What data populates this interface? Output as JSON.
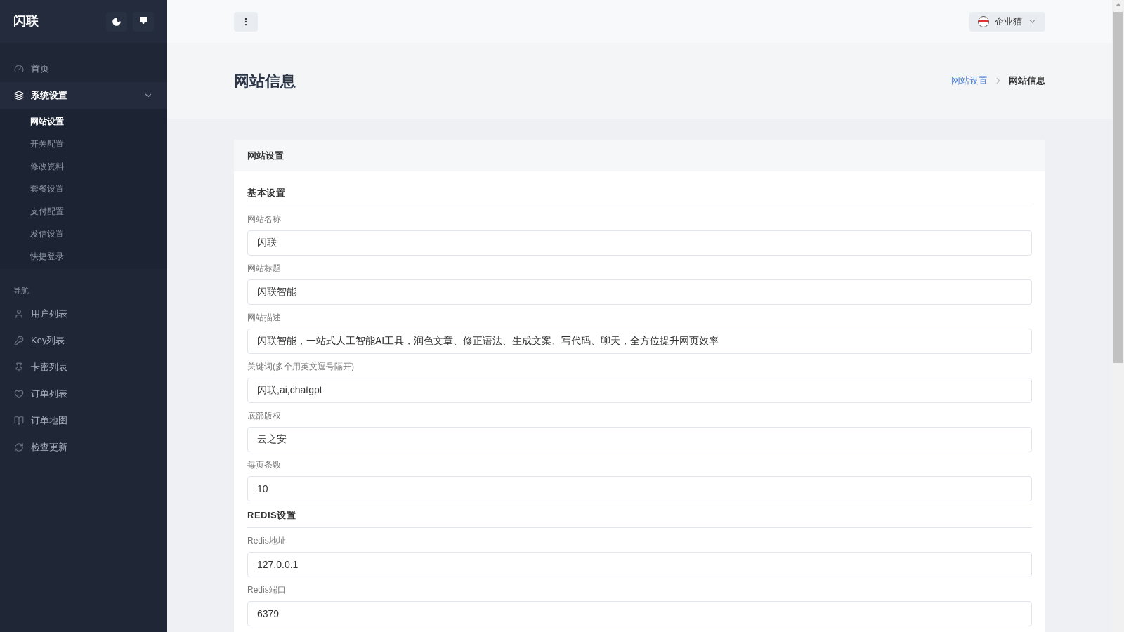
{
  "sidebar": {
    "brand": "闪联",
    "menu": [
      {
        "label": "首页",
        "selected": false
      },
      {
        "label": "系统设置",
        "selected": true,
        "expanded": true,
        "children": [
          {
            "label": "网站设置",
            "selected": true
          },
          {
            "label": "开关配置",
            "selected": false
          },
          {
            "label": "修改资料",
            "selected": false
          },
          {
            "label": "套餐设置",
            "selected": false
          },
          {
            "label": "支付配置",
            "selected": false
          },
          {
            "label": "发信设置",
            "selected": false
          },
          {
            "label": "快捷登录",
            "selected": false
          }
        ]
      }
    ],
    "nav_heading": "导航",
    "nav_items": [
      {
        "label": "用户列表",
        "selected": false
      },
      {
        "label": "Key列表",
        "selected": false
      },
      {
        "label": "卡密列表",
        "selected": false
      },
      {
        "label": "订单列表",
        "selected": false
      },
      {
        "label": "订单地图",
        "selected": false
      },
      {
        "label": "检查更新",
        "selected": false
      }
    ]
  },
  "topbar": {
    "user": "企业猫"
  },
  "page": {
    "title": "网站信息",
    "breadcrumb": [
      {
        "label": "网站设置",
        "link": true
      },
      {
        "label": "网站信息",
        "link": false
      }
    ]
  },
  "card": {
    "title": "网站设置",
    "sections": [
      {
        "heading": "基本设置",
        "fields": [
          {
            "label": "网站名称",
            "value": "闪联"
          },
          {
            "label": "网站标题",
            "value": "闪联智能"
          },
          {
            "label": "网站描述",
            "value": "闪联智能，一站式人工智能AI工具，润色文章、修正语法、生成文案、写代码、聊天，全方位提升网页效率"
          },
          {
            "label": "关键词(多个用英文逗号隔开)",
            "value": "闪联,ai,chatgpt"
          },
          {
            "label": "底部版权",
            "value": "云之安"
          },
          {
            "label": "每页条数",
            "value": "10"
          }
        ]
      },
      {
        "heading": "REDIS设置",
        "fields": [
          {
            "label": "Redis地址",
            "value": "127.0.0.1"
          },
          {
            "label": "Redis端口",
            "value": "6379"
          }
        ]
      }
    ]
  }
}
